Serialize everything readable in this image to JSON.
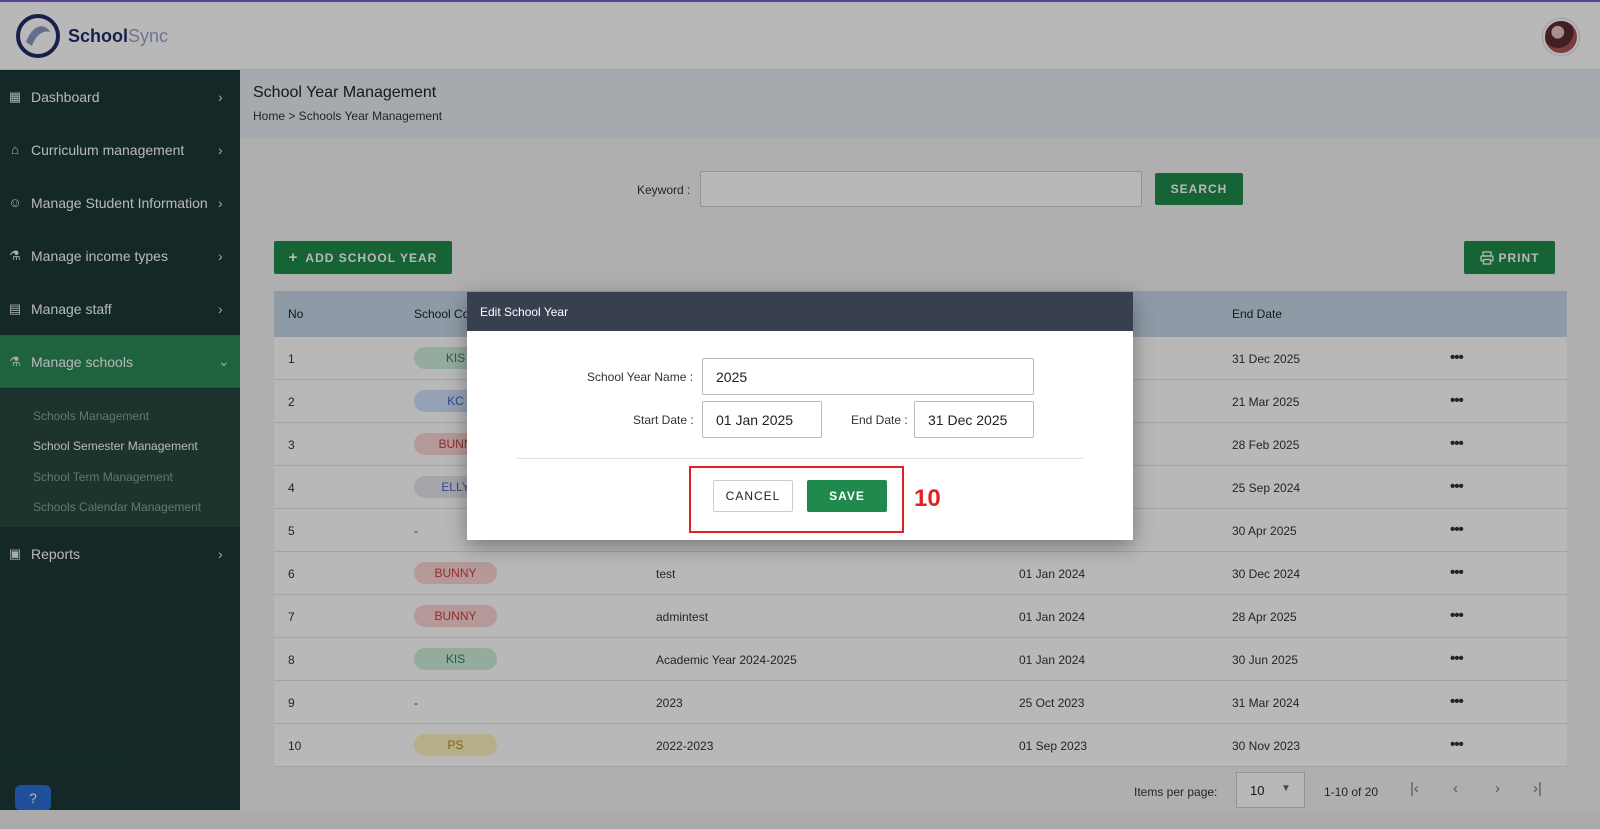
{
  "app": {
    "name_primary": "School",
    "name_secondary": "Sync"
  },
  "sidebar": {
    "items": [
      {
        "label": "Dashboard",
        "icon": "grid-icon"
      },
      {
        "label": "Curriculum management",
        "icon": "graduation-cap-icon"
      },
      {
        "label": "Manage Student Information",
        "icon": "student-icon"
      },
      {
        "label": "Manage income types",
        "icon": "flask-icon"
      },
      {
        "label": "Manage staff",
        "icon": "id-card-icon"
      },
      {
        "label": "Manage schools",
        "icon": "school-icon"
      },
      {
        "label": "Reports",
        "icon": "clipboard-icon"
      }
    ],
    "sub_items": [
      {
        "label": "Schools Management"
      },
      {
        "label": "School Semester Management"
      },
      {
        "label": "School Term Management"
      },
      {
        "label": "Schools Calendar Management"
      }
    ]
  },
  "header": {
    "title": "School Year Management",
    "breadcrumb": "Home > Schools Year Management"
  },
  "search": {
    "label": "Keyword :",
    "value": "",
    "button": "SEARCH"
  },
  "toolbar": {
    "add_label": "ADD SCHOOL YEAR",
    "print_label": "PRINT"
  },
  "table": {
    "columns": {
      "no": "No",
      "school_code": "School Co",
      "end_date": "End Date"
    },
    "rows": [
      {
        "no": "1",
        "code": "KIS",
        "name": "",
        "start": "",
        "end": "31 Dec 2025"
      },
      {
        "no": "2",
        "code": "KC",
        "name": "",
        "start": "",
        "end": "21 Mar 2025"
      },
      {
        "no": "3",
        "code": "BUNN",
        "name": "",
        "start": "",
        "end": "28 Feb 2025"
      },
      {
        "no": "4",
        "code": "ELLY",
        "name": "",
        "start": "",
        "end": "25 Sep 2024"
      },
      {
        "no": "5",
        "code": "-",
        "name": "",
        "start": "",
        "end": "30 Apr 2025"
      },
      {
        "no": "6",
        "code": "BUNNY",
        "name": "test",
        "start": "01 Jan 2024",
        "end": "30 Dec 2024"
      },
      {
        "no": "7",
        "code": "BUNNY",
        "name": "admintest",
        "start": "01 Jan 2024",
        "end": "28 Apr 2025"
      },
      {
        "no": "8",
        "code": "KIS",
        "name": "Academic Year 2024-2025",
        "start": "01 Jan 2024",
        "end": "30 Jun 2025"
      },
      {
        "no": "9",
        "code": "-",
        "name": "2023",
        "start": "25 Oct 2023",
        "end": "31 Mar 2024"
      },
      {
        "no": "10",
        "code": "PS",
        "name": "2022-2023",
        "start": "01 Sep 2023",
        "end": "30 Nov 2023"
      }
    ],
    "actions_glyph": "•••"
  },
  "pagination": {
    "items_per_page_label": "Items per page:",
    "items_per_page": "10",
    "range": "1-10 of 20"
  },
  "dialog": {
    "title": "Edit School Year",
    "name_label": "School Year Name :",
    "name_value": "2025",
    "start_label": "Start Date :",
    "start_value": "01 Jan 2025",
    "end_label": "End Date :",
    "end_value": "31 Dec 2025",
    "cancel_label": "CANCEL",
    "save_label": "SAVE"
  },
  "annotation": {
    "step": "10",
    "color": "#e02222"
  },
  "colors": {
    "primary": "#1f8a4c",
    "sidebar": "#1d3a36",
    "dialog_header": "#383f4f"
  }
}
